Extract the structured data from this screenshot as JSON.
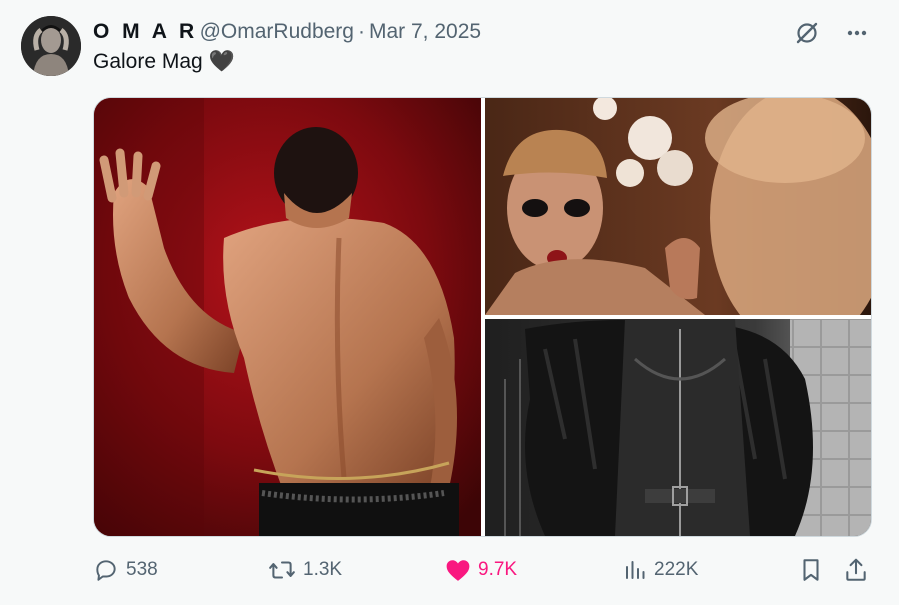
{
  "tweet": {
    "display_name": "O M A R",
    "handle": "@OmarRudberg",
    "separator": "·",
    "date": "Mar 7, 2025",
    "text": "Galore Mag",
    "emoji": "🖤"
  },
  "media": {
    "count": 3
  },
  "actions": {
    "replies": "538",
    "reposts": "1.3K",
    "likes": "9.7K",
    "views": "222K",
    "liked": true
  },
  "colors": {
    "text_primary": "#0f1419",
    "text_secondary": "#536471",
    "like_active": "#f91880",
    "background": "#f7f9f9"
  },
  "icons": {
    "grok": "grok-icon",
    "more": "more-icon",
    "reply": "reply-icon",
    "repost": "repost-icon",
    "like": "heart-icon",
    "views": "views-icon",
    "bookmark": "bookmark-icon",
    "share": "share-icon"
  }
}
